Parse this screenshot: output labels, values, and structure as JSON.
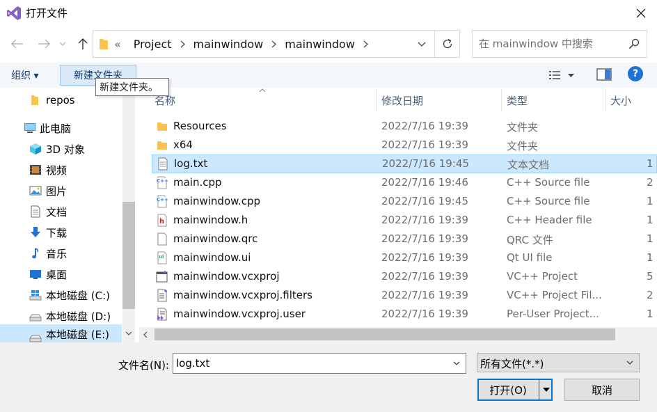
{
  "window": {
    "title": "打开文件"
  },
  "address": {
    "overflow": "«",
    "crumbs": [
      "Project",
      "mainwindow",
      "mainwindow"
    ]
  },
  "search": {
    "placeholder": "在 mainwindow 中搜索"
  },
  "toolbar": {
    "organize": "组织 ▾",
    "new_folder": "新建文件夹",
    "tooltip": "新建文件夹。",
    "help": "?"
  },
  "nav": {
    "items": [
      {
        "label": "repos",
        "icon": "folder-icon"
      },
      {
        "label": "此电脑",
        "icon": "computer-icon"
      },
      {
        "label": "3D 对象",
        "icon": "3d-objects-icon"
      },
      {
        "label": "视频",
        "icon": "video-icon"
      },
      {
        "label": "图片",
        "icon": "pictures-icon"
      },
      {
        "label": "文档",
        "icon": "documents-icon"
      },
      {
        "label": "下载",
        "icon": "download-icon"
      },
      {
        "label": "音乐",
        "icon": "music-icon"
      },
      {
        "label": "桌面",
        "icon": "desktop-icon"
      },
      {
        "label": "本地磁盘 (C:)",
        "icon": "windows-drive-icon"
      },
      {
        "label": "本地磁盘 (D:)",
        "icon": "drive-icon"
      },
      {
        "label": "本地磁盘 (E:)",
        "icon": "drive-icon"
      }
    ]
  },
  "columns": {
    "name": "名称",
    "date": "修改日期",
    "type": "类型",
    "size": "大小"
  },
  "files": [
    {
      "name": "Resources",
      "date": "2022/7/16 19:39",
      "type": "文件夹",
      "size": "",
      "icon": "folder-icon"
    },
    {
      "name": "x64",
      "date": "2022/7/16 19:39",
      "type": "文件夹",
      "size": "",
      "icon": "folder-icon"
    },
    {
      "name": "log.txt",
      "date": "2022/7/16 19:45",
      "type": "文本文档",
      "size": "1",
      "icon": "text-file-icon",
      "selected": true
    },
    {
      "name": "main.cpp",
      "date": "2022/7/16 19:46",
      "type": "C++ Source file",
      "size": "2",
      "icon": "cpp-file-icon"
    },
    {
      "name": "mainwindow.cpp",
      "date": "2022/7/16 19:45",
      "type": "C++ Source file",
      "size": "1",
      "icon": "cpp-file-icon"
    },
    {
      "name": "mainwindow.h",
      "date": "2022/7/16 19:39",
      "type": "C++ Header file",
      "size": "1",
      "icon": "header-file-icon"
    },
    {
      "name": "mainwindow.qrc",
      "date": "2022/7/16 19:39",
      "type": "QRC 文件",
      "size": "1",
      "icon": "blank-file-icon"
    },
    {
      "name": "mainwindow.ui",
      "date": "2022/7/16 19:39",
      "type": "Qt UI file",
      "size": "1",
      "icon": "ui-file-icon"
    },
    {
      "name": "mainwindow.vcxproj",
      "date": "2022/7/16 19:39",
      "type": "VC++ Project",
      "size": "5",
      "icon": "vcxproj-file-icon"
    },
    {
      "name": "mainwindow.vcxproj.filters",
      "date": "2022/7/16 19:39",
      "type": "VC++ Project Fil...",
      "size": "2",
      "icon": "filters-file-icon"
    },
    {
      "name": "mainwindow.vcxproj.user",
      "date": "2022/7/16 19:39",
      "type": "Per-User Project...",
      "size": "1",
      "icon": "user-file-icon"
    }
  ],
  "bottom": {
    "filename_label": "文件名(N):",
    "filename_value": "log.txt",
    "filter_value": "所有文件(*.*)",
    "open_label": "打开(O)",
    "cancel_label": "取消"
  },
  "colors": {
    "accent": "#0078d7",
    "selection": "#cce8ff",
    "folder": "#f8c44f"
  }
}
